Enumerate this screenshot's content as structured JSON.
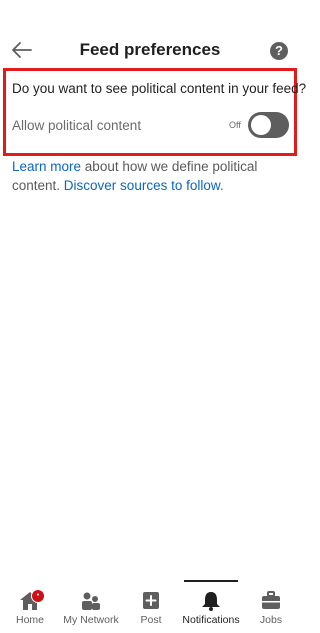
{
  "header": {
    "title": "Feed preferences",
    "back_icon": "arrow-left-icon",
    "help_icon": "question-circle-icon",
    "help_glyph": "?"
  },
  "political": {
    "question": "Do you want to see political content in your feed?",
    "toggle_label": "Allow political content",
    "toggle_state": "Off",
    "toggle_on": false
  },
  "info": {
    "learn_more": "Learn more",
    "middle": " about how we define political content. ",
    "discover": "Discover sources to follow."
  },
  "tabbar": {
    "home": {
      "label": "Home",
      "icon": "home-icon",
      "badge": "•"
    },
    "network": {
      "label": "My Network",
      "icon": "people-icon"
    },
    "post": {
      "label": "Post",
      "icon": "plus-square-icon"
    },
    "notifications": {
      "label": "Notifications",
      "icon": "bell-icon",
      "active": true
    },
    "jobs": {
      "label": "Jobs",
      "icon": "briefcase-icon"
    }
  },
  "colors": {
    "highlight": "#e21b1b",
    "link": "#0a66c2",
    "toggle_off": "#5e5e5e",
    "badge": "#cc1016"
  }
}
